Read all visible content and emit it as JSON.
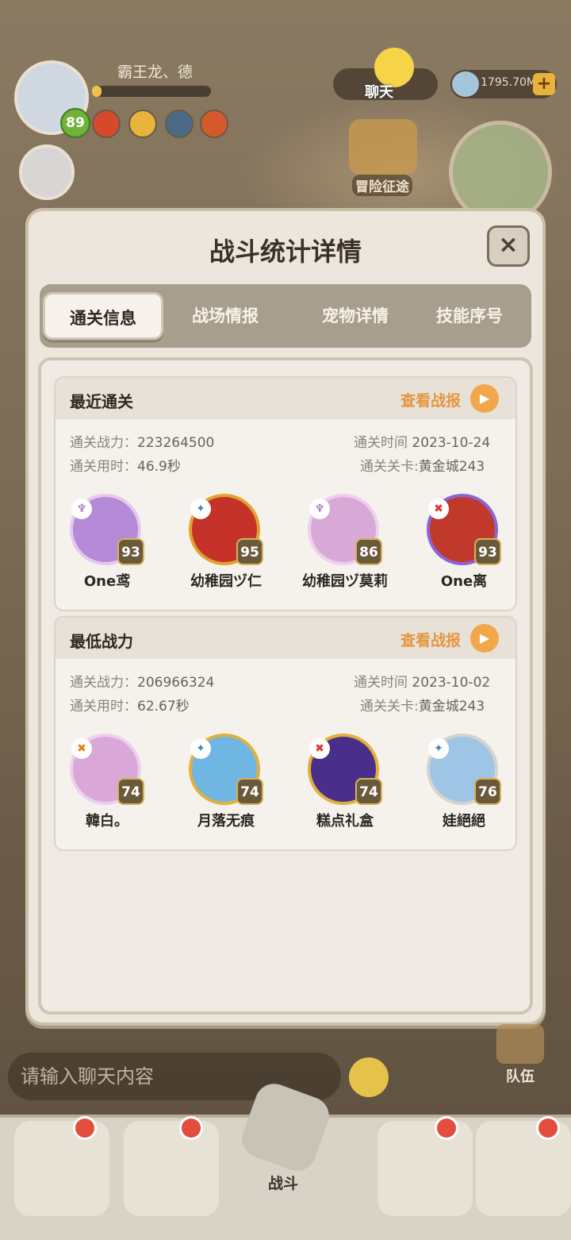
{
  "hud": {
    "player_name": "霸王龙、德",
    "player_level": "89",
    "currency": "1795.70M",
    "chat_label": "聊天",
    "adventure_label": "冒险征途",
    "team_label": "队伍",
    "chat_placeholder": "请输入聊天内容",
    "fight_label": "战斗"
  },
  "modal": {
    "title": "战斗统计详情",
    "close_symbol": "×",
    "tabs": [
      {
        "label": "通关信息",
        "active": true
      },
      {
        "label": "战场情报",
        "active": false
      },
      {
        "label": "宠物详情",
        "active": false
      },
      {
        "label": "技能序号",
        "active": false
      }
    ]
  },
  "sections": [
    {
      "title": "最近通关",
      "view_label": "查看战报",
      "power_label": "通关战力：",
      "power_value": "223264500",
      "time_label": "通关时间",
      "time_value": "2023-10-24",
      "duration_label": "通关用时：",
      "duration_value": "46.9秒",
      "stage_label": "通关关卡:",
      "stage_value": "黄金城243",
      "pets": [
        {
          "name": "One鸢",
          "level": "93",
          "color": "#b58ad6",
          "ring": "#e6c8ef"
        },
        {
          "name": "幼稚园ヅ仁",
          "level": "95",
          "color": "#c4322a",
          "ring": "#e0a32e"
        },
        {
          "name": "幼稚园ヅ莫莉",
          "level": "86",
          "color": "#d8a9d6",
          "ring": "#ecd0ee"
        },
        {
          "name": "One离",
          "level": "93",
          "color": "#c0392b",
          "ring": "#8c63d8"
        }
      ]
    },
    {
      "title": "最低战力",
      "view_label": "查看战报",
      "power_label": "通关战力：",
      "power_value": "206966324",
      "time_label": "通关时间",
      "time_value": "2023-10-02",
      "duration_label": "通关用时：",
      "duration_value": "62.67秒",
      "stage_label": "通关关卡:",
      "stage_value": "黄金城243",
      "pets": [
        {
          "name": "韓白。",
          "level": "74",
          "color": "#d9a7d8",
          "ring": "#ecd0ee"
        },
        {
          "name": "月落无痕",
          "level": "74",
          "color": "#6fb6e3",
          "ring": "#e0b23c"
        },
        {
          "name": "糕点礼盒",
          "level": "74",
          "color": "#4a2f8a",
          "ring": "#e0b23c"
        },
        {
          "name": "娃絕絕",
          "level": "76",
          "color": "#9ec5e6",
          "ring": "#d6d3cf"
        }
      ]
    }
  ]
}
